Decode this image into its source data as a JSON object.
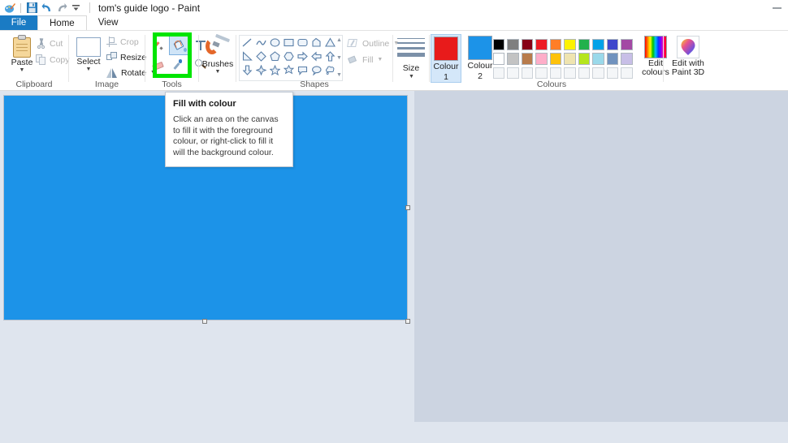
{
  "window": {
    "title": "tom's guide logo - Paint",
    "minimize_label": "Minimize",
    "quick_access": [
      {
        "name": "app-icon",
        "label": "Paint"
      },
      {
        "name": "save-icon",
        "label": "Save"
      },
      {
        "name": "undo-icon",
        "label": "Undo"
      },
      {
        "name": "redo-icon",
        "label": "Redo"
      },
      {
        "name": "customize-icon",
        "label": "Customize Quick Access Toolbar"
      }
    ]
  },
  "tabs": [
    {
      "label": "File",
      "active": false
    },
    {
      "label": "Home",
      "active": true
    },
    {
      "label": "View",
      "active": false
    }
  ],
  "ribbon": {
    "groups": [
      {
        "label": "Clipboard"
      },
      {
        "label": "Image"
      },
      {
        "label": "Tools"
      },
      {
        "label": "Brushes"
      },
      {
        "label": "Shapes"
      },
      {
        "label": "Size"
      },
      {
        "label": "Colours"
      }
    ],
    "clipboard": {
      "paste": "Paste",
      "cut": "Cut",
      "copy": "Copy"
    },
    "image": {
      "select": "Select",
      "crop": "Crop",
      "resize": "Resize",
      "rotate": "Rotate"
    },
    "tools": {
      "items": [
        {
          "name": "pencil-tool",
          "label": "Pencil",
          "selected": false
        },
        {
          "name": "fill-with-colour-tool",
          "label": "Fill with colour",
          "selected": true
        },
        {
          "name": "text-tool",
          "label": "Text",
          "selected": false
        },
        {
          "name": "eraser-tool",
          "label": "Eraser",
          "selected": false
        },
        {
          "name": "colour-picker-tool",
          "label": "Colour picker",
          "selected": false
        },
        {
          "name": "magnifier-tool",
          "label": "Magnifier",
          "selected": false
        }
      ]
    },
    "brushes": {
      "label": "Brushes"
    },
    "shapes": {
      "row1": [
        "line",
        "curve",
        "oval",
        "rectangle",
        "rounded-rectangle",
        "polygon",
        "triangle"
      ],
      "row2": [
        "right-triangle",
        "diamond",
        "pentagon",
        "hexagon",
        "right-arrow",
        "left-arrow",
        "up-arrow"
      ],
      "row3": [
        "down-arrow",
        "four-point-star",
        "five-point-star",
        "six-point-star",
        "rounded-callout",
        "oval-callout",
        "cloud-callout"
      ],
      "outline": "Outline",
      "fill": "Fill"
    },
    "size": {
      "label": "Size"
    },
    "colours": {
      "colour1_label": "Colour",
      "colour1_num": "1",
      "colour1_value": "#e81b1b",
      "colour2_label": "Colour",
      "colour2_num": "2",
      "colour2_value": "#1c93e8",
      "edit_colours": "Edit colours",
      "edit_paint3d_line1": "Edit with",
      "edit_paint3d_line2": "Paint 3D",
      "palette_row1": [
        "#000000",
        "#7f7f7f",
        "#870016",
        "#ed1c24",
        "#ff7e27",
        "#fef200",
        "#22b14c",
        "#00a2e8",
        "#3f48cc",
        "#a349a4"
      ],
      "palette_row2": [
        "#ffffff",
        "#c3c3c3",
        "#b87c4c",
        "#feaec9",
        "#fec20c",
        "#efe4b0",
        "#b5e51d",
        "#9ad9ea",
        "#7092be",
        "#c8bfe7"
      ],
      "palette_row3": [
        "",
        "",
        "",
        "",
        "",
        "",
        "",
        "",
        "",
        ""
      ]
    }
  },
  "tooltip": {
    "title": "Fill with colour",
    "body": "Click an area on the canvas to fill it with the foreground colour, or right-click to fill it will the background colour."
  },
  "canvas": {
    "fill_colour": "#1c93e8",
    "handles": [
      "right-middle",
      "bottom-middle",
      "bottom-right-corner"
    ]
  },
  "highlight": {
    "colour": "#00e500",
    "target": "fill-with-colour-tool"
  }
}
